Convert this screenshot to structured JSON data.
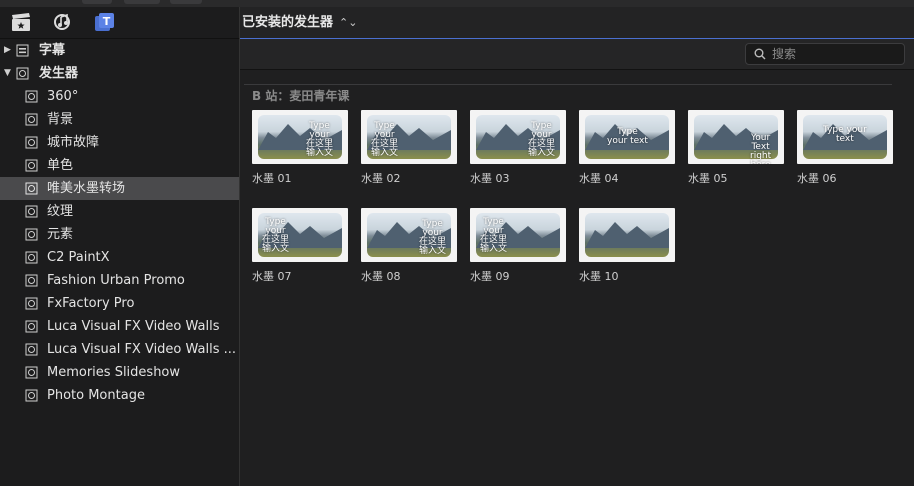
{
  "sidebar": {
    "items": [
      {
        "label": "字幕",
        "level": "top",
        "expanded": false
      },
      {
        "label": "发生器",
        "level": "top",
        "expanded": true
      },
      {
        "label": "360°",
        "level": "sub"
      },
      {
        "label": "背景",
        "level": "sub"
      },
      {
        "label": "城市故障",
        "level": "sub"
      },
      {
        "label": "单色",
        "level": "sub"
      },
      {
        "label": "唯美水墨转场",
        "level": "sub",
        "selected": true
      },
      {
        "label": "纹理",
        "level": "sub"
      },
      {
        "label": "元素",
        "level": "sub"
      },
      {
        "label": "C2 PaintX",
        "level": "sub"
      },
      {
        "label": "Fashion Urban Promo",
        "level": "sub"
      },
      {
        "label": "FxFactory Pro",
        "level": "sub"
      },
      {
        "label": "Luca Visual FX Video Walls",
        "level": "sub"
      },
      {
        "label": "Luca Visual FX Video Walls ...",
        "level": "sub"
      },
      {
        "label": "Memories Slideshow",
        "level": "sub"
      },
      {
        "label": "Photo Montage",
        "level": "sub"
      }
    ]
  },
  "header": {
    "title": "已安装的发生器",
    "chevron": "⌃⌄"
  },
  "search": {
    "placeholder": "搜索",
    "value": ""
  },
  "group": {
    "label": "B 站：麦田青年课"
  },
  "tiles": [
    {
      "caption": "水墨 01",
      "overlay": "Type\nyour\n在这里\n输入文"
    },
    {
      "caption": "水墨 02",
      "overlay": "Type\nyour\n在这里\n输入文"
    },
    {
      "caption": "水墨 03",
      "overlay": "Type\nyour\n在这里\n输入文"
    },
    {
      "caption": "水墨 04",
      "overlay": "Type\nyour text"
    },
    {
      "caption": "水墨 05",
      "overlay": "Your\nText\nright\nhere"
    },
    {
      "caption": "水墨 06",
      "overlay": "Type your\ntext"
    },
    {
      "caption": "水墨 07",
      "overlay": "Type\nyour\n在这里\n输入文"
    },
    {
      "caption": "水墨 08",
      "overlay": "Type\nyour\n在这里\n输入文"
    },
    {
      "caption": "水墨 09",
      "overlay": "Type\nyour\n在这里\n输入文"
    },
    {
      "caption": "水墨 10",
      "overlay": ""
    }
  ],
  "colors": {
    "accent": "#4a6fd0",
    "selected": "#4a4a4c",
    "background": "#1f1f20"
  },
  "icons": [
    "clapper-icon",
    "music-icon",
    "titles-icon",
    "generator-icon",
    "search-icon"
  ]
}
